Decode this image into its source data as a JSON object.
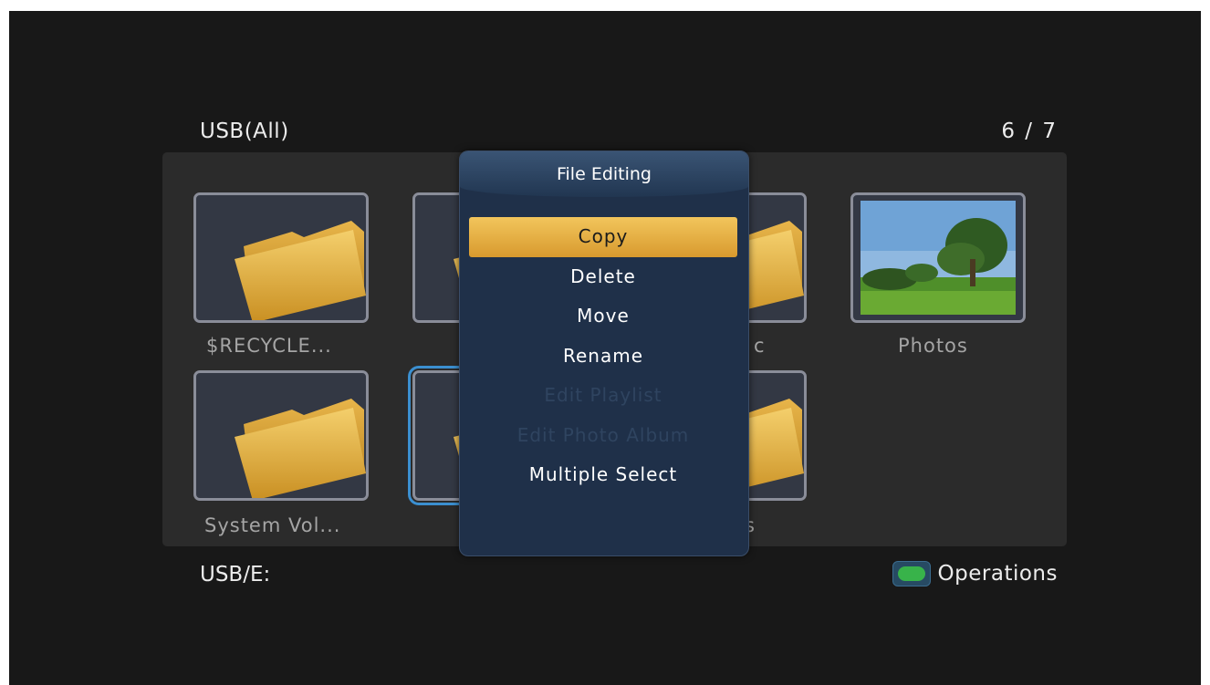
{
  "header": {
    "source": "USB(All)",
    "page": "6 / 7"
  },
  "tiles": [
    {
      "label": "$RECYCLE...",
      "type": "folder"
    },
    {
      "label": "",
      "type": "folder"
    },
    {
      "label": "c",
      "type": "folder"
    },
    {
      "label": "Photos",
      "type": "photo"
    },
    {
      "label": "System Vol...",
      "type": "folder"
    },
    {
      "label": "",
      "type": "folder"
    },
    {
      "label": "s",
      "type": "folder"
    }
  ],
  "footer": {
    "path": "USB/E:",
    "operations_label": "Operations"
  },
  "dialog": {
    "title": "File Editing",
    "items": [
      {
        "label": "Copy",
        "state": "active"
      },
      {
        "label": "Delete",
        "state": "enabled"
      },
      {
        "label": "Move",
        "state": "enabled"
      },
      {
        "label": "Rename",
        "state": "enabled"
      },
      {
        "label": "Edit Playlist",
        "state": "disabled"
      },
      {
        "label": "Edit Photo Album",
        "state": "disabled"
      },
      {
        "label": "Multiple Select",
        "state": "enabled"
      }
    ]
  },
  "colors": {
    "highlight": "#e6b04a",
    "dialog_bg": "#1f3049",
    "selection_outline": "#3b8fd0",
    "operations_key": "#38b34a"
  }
}
